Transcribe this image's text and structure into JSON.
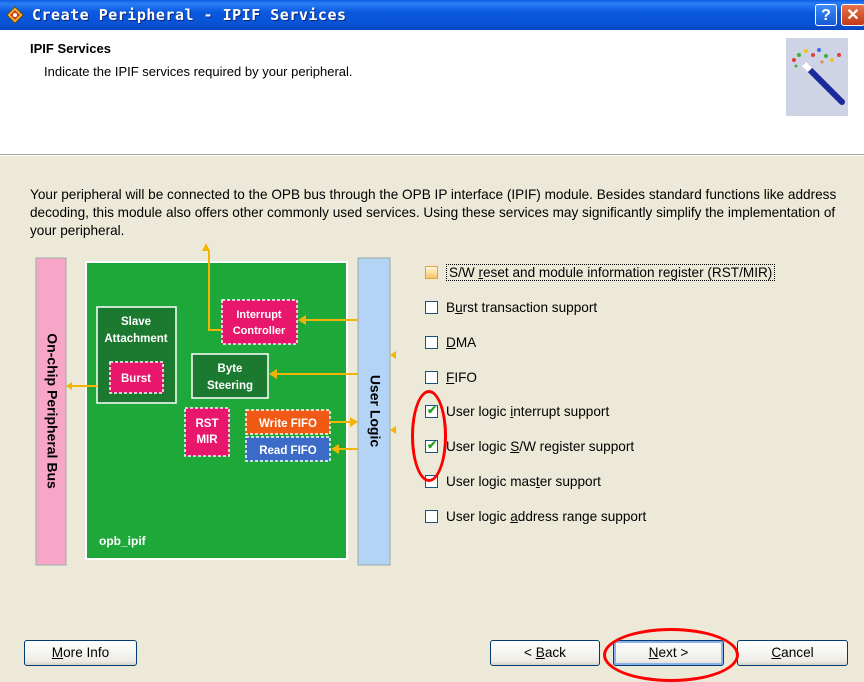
{
  "window": {
    "title": "Create Peripheral - IPIF Services",
    "help_label": "?",
    "close_label": "✕"
  },
  "header": {
    "title": "IPIF Services",
    "subtitle": "Indicate the IPIF services required by your peripheral."
  },
  "description": "Your peripheral will be connected to the OPB bus through the OPB IP interface (IPIF) module. Besides standard functions like address decoding, this module also offers other commonly used services. Using these services may significantly simplify the implementation of your peripheral.",
  "diagram": {
    "bus_label": "On-chip Peripheral Bus",
    "user_logic_label": "User Logic",
    "module_label": "opb_ipif",
    "slave_line1": "Slave",
    "slave_line2": "Attachment",
    "burst": "Burst",
    "interrupt_line1": "Interrupt",
    "interrupt_line2": "Controller",
    "byte_line1": "Byte",
    "byte_line2": "Steering",
    "rst": "RST",
    "mir": "MIR",
    "write_fifo": "Write FIFO",
    "read_fifo": "Read FIFO",
    "colors": {
      "module": "#1fa83a",
      "bus": "#f7a6c8",
      "user_logic": "#b4d4f5",
      "magenta": "#e8176b",
      "orange": "#f05a14",
      "blue": "#3c6cc8",
      "arrow": "#f5b400"
    }
  },
  "options": [
    {
      "id": "rst_mir",
      "pre": "S/W ",
      "ul": "r",
      "post": "eset and module information register (RST/MIR)",
      "checked": false
    },
    {
      "id": "burst",
      "pre": "B",
      "ul": "u",
      "post": "rst transaction support",
      "checked": false
    },
    {
      "id": "dma",
      "pre": "",
      "ul": "D",
      "post": "MA",
      "checked": false
    },
    {
      "id": "fifo",
      "pre": "",
      "ul": "F",
      "post": "IFO",
      "checked": false
    },
    {
      "id": "interrupt",
      "pre": "User logic ",
      "ul": "i",
      "post": "nterrupt support",
      "checked": true
    },
    {
      "id": "sw_reg",
      "pre": "User logic ",
      "ul": "S",
      "post": "/W register support",
      "checked": true
    },
    {
      "id": "master",
      "pre": "User logic mas",
      "ul": "t",
      "post": "er support",
      "checked": false
    },
    {
      "id": "addr_range",
      "pre": "User logic ",
      "ul": "a",
      "post": "ddress range support",
      "checked": false
    }
  ],
  "buttons": {
    "more_info": {
      "ul": "M",
      "rest": "ore Info"
    },
    "back": {
      "pre": "< ",
      "ul": "B",
      "rest": "ack"
    },
    "next": {
      "ul": "N",
      "rest": "ext >"
    },
    "cancel": {
      "ul": "C",
      "rest": "ancel"
    }
  }
}
